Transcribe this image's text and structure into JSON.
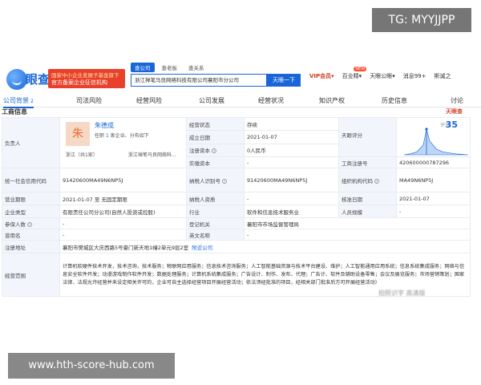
{
  "watermarks": {
    "top": "TG: MYYJJPP",
    "bottom": "www.hth-score-hub.com"
  },
  "header": {
    "logo_text": "眼查",
    "promo_line1": "国家中小企业发展子基金旗下",
    "promo_line2": "官方备案企业征信机构",
    "search_tabs": [
      "查公司",
      "查老板",
      "查关系"
    ],
    "search_value": "浙江禅笔马良网络科技有限公司襄阳市分公司",
    "search_button": "天眼一下",
    "nav": [
      {
        "label": "VIP会员",
        "vip": true,
        "arrow": "▾"
      },
      {
        "label": "百业精",
        "arrow": "▾",
        "badge": "NEW"
      },
      {
        "label": "天眼公眼",
        "arrow": "▾"
      },
      {
        "label": "消息99+"
      },
      {
        "label": "斯诚之"
      }
    ]
  },
  "tabs": [
    {
      "label": "公司背景",
      "count": "2",
      "active": true
    },
    {
      "label": "司法风险"
    },
    {
      "label": "经营风险"
    },
    {
      "label": "公司发展"
    },
    {
      "label": "经营状况"
    },
    {
      "label": "知识产权"
    },
    {
      "label": "历史信息"
    },
    {
      "label": "讨论"
    }
  ],
  "section_title": "工商信息",
  "report_tag": "天眼查",
  "info": {
    "person_label": "负责人",
    "person_avatar": "朱",
    "person_name": "朱德成",
    "person_meta_prefix": "任职",
    "person_meta_num1": "1",
    "person_meta_mid": "家企业、分布如下",
    "person_org_left": "浙江（共1家）",
    "person_org_right": "浙江禅笔马良网络科...",
    "status_label": "经营状态",
    "status_value": "存续",
    "founded_label": "成立日期",
    "founded_value": "2021-01-07",
    "capital_label": "注册资本",
    "capital_value": "0人民币",
    "paid_label": "实缴资本",
    "paid_value": "-",
    "score_label": "天眼评分",
    "score_caption": "评分",
    "score_value": "35",
    "regno_label": "工商注册号",
    "regno_value": "420600000787296",
    "credit_label": "统一社会信用代码",
    "credit_value": "91420600MA49N6NP5J",
    "taxid_label": "纳税人识别号",
    "taxid_value": "91420600MA49N6NP5J",
    "orgcode_label": "组织机构代码",
    "orgcode_value": "MA49N6NP5J",
    "term_label": "营业期限",
    "term_value": "2021-01-07 至 无固定期限",
    "taxq_label": "纳税人资质",
    "taxq_value": "-",
    "approve_label": "核准日期",
    "approve_value": "2021-01-07",
    "type_label": "企业类型",
    "type_value": "有限责任公司分公司(自然人投资或控股)",
    "industry_label": "行业",
    "industry_value": "软件和信息技术服务业",
    "staff_label": "人员规模",
    "staff_value": "-",
    "insured_label": "参保人数",
    "insured_value": "-",
    "authority_label": "登记机关",
    "authority_value": "襄阳市市场监督管理局",
    "usedname_label": "曾用名",
    "usedname_value": "-",
    "engname_label": "英文名称",
    "engname_value": "-",
    "address_label": "注册地址",
    "address_value": "襄阳市樊城区大庆西路5号豪门新天地1幢2单元9层2室",
    "address_link": "附近公司",
    "scope_label": "经营范围",
    "scope_value": "计算机软硬件技术开发，技术咨询，技术服务；物联网应用服务；信息技术咨询服务；人工智能基础资源与技术平台建设、维护；人工智能通用应用系统；信息系统集成服务；网络与信息安全软件开发；动漫游戏制作软件开发；数据处理服务；计算机系统集成服务；广告设计、制作、发布、代理；广告计、软件及辅助设备零售；会议及展览服务；市场营销策划；国家法律、法规允许经营并未设定相关许可的，企业可自主选择经营项目开展经营活动；依法须经批准的项目，经相关部门批准后方可开展经营活动）"
  },
  "blurred_text": "拍照识字 高清版",
  "chart_data": {
    "type": "area",
    "title": "",
    "xlabel": "",
    "ylabel": "",
    "x": [
      0,
      10,
      20,
      30,
      35,
      40,
      50,
      60,
      70,
      80,
      90,
      100
    ],
    "values": [
      0,
      1,
      3,
      10,
      26,
      14,
      6,
      3,
      2,
      1,
      0.5,
      0
    ],
    "marker": 35,
    "colors": {
      "fill": "#bcd6f7",
      "stroke": "#1a66d8"
    }
  },
  "colors": {
    "accent": "#1a66d8",
    "label_bg": "#f2f6fc",
    "border": "#e8ebf0",
    "vip": "#d4381f"
  }
}
